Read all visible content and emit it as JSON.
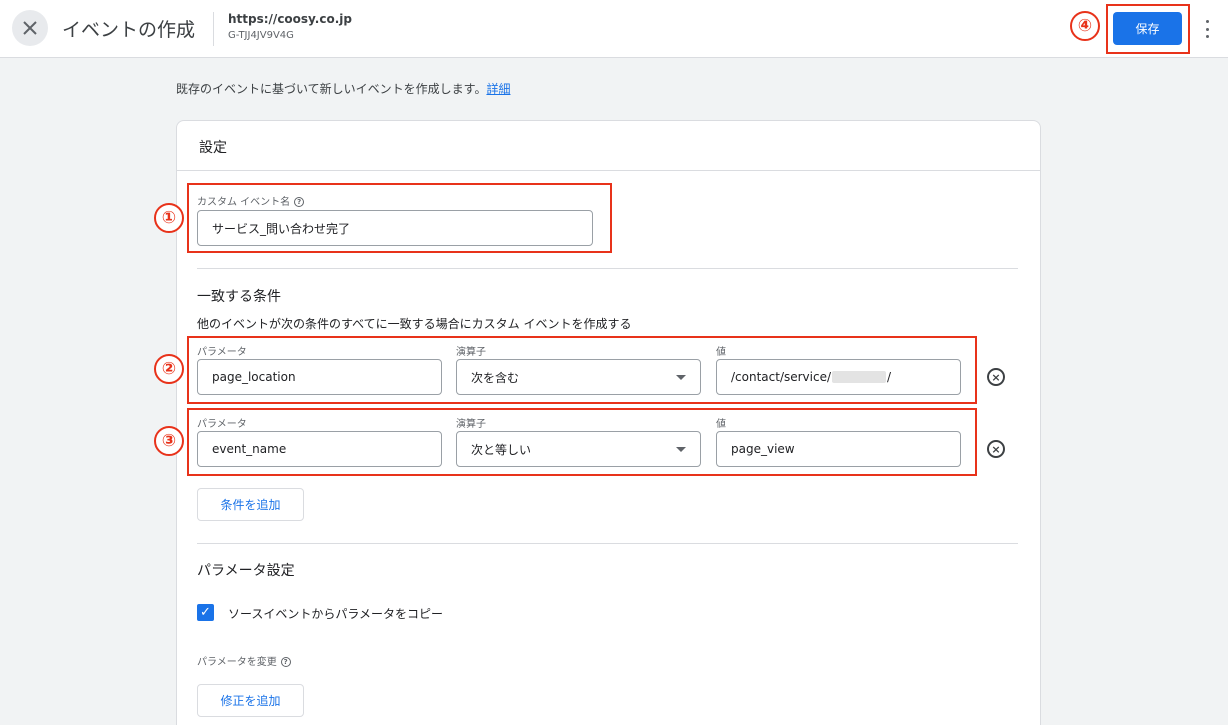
{
  "header": {
    "title": "イベントの作成",
    "site_url": "https://coosy.co.jp",
    "measurement_id": "G-TJJ4JV9V4G",
    "save_label": "保存"
  },
  "intro": {
    "text": "既存のイベントに基づいて新しいイベントを作成します。",
    "link": "詳細"
  },
  "settings": {
    "title": "設定",
    "custom_event_label": "カスタム イベント名",
    "custom_event_value": "サービス_問い合わせ完了"
  },
  "conditions": {
    "title": "一致する条件",
    "description": "他のイベントが次の条件のすべてに一致する場合にカスタム イベントを作成する",
    "rows": [
      {
        "param_label": "パラメータ",
        "param_value": "page_location",
        "op_label": "演算子",
        "op_value": "次を含む",
        "value_label": "値",
        "value_prefix": "/contact/service/",
        "value_suffix": "/"
      },
      {
        "param_label": "パラメータ",
        "param_value": "event_name",
        "op_label": "演算子",
        "op_value": "次と等しい",
        "value_label": "値",
        "value": "page_view"
      }
    ],
    "add_label": "条件を追加"
  },
  "param_settings": {
    "title": "パラメータ設定",
    "copy_label": "ソースイベントからパラメータをコピー",
    "copy_checked": true,
    "modify_label": "パラメータを変更",
    "add_modify_label": "修正を追加"
  },
  "annotations": {
    "m1": "①",
    "m2": "②",
    "m3": "③",
    "m4": "④"
  },
  "colors": {
    "accent": "#1a73e8",
    "annotation": "#e8321a"
  }
}
